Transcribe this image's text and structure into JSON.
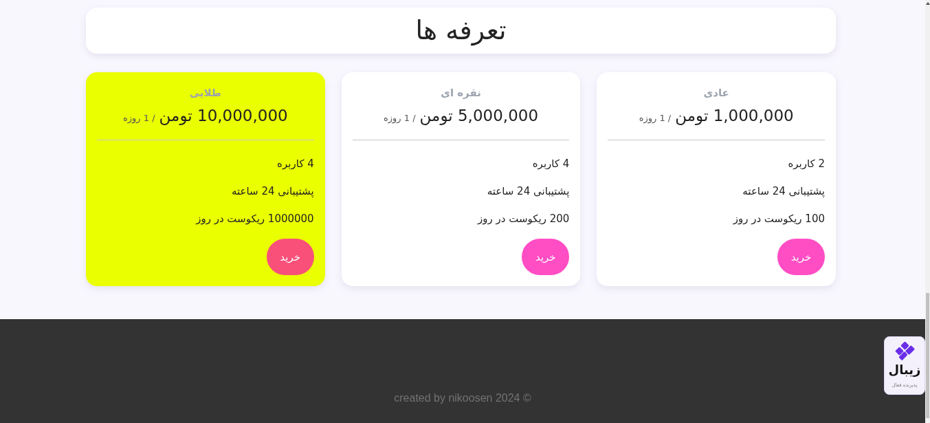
{
  "page": {
    "title": "تعرفه ها"
  },
  "plans": [
    {
      "name": "عادی",
      "price": "1,000,000 تومن",
      "period": "/ 1 روزه",
      "features": [
        "2 کاربره",
        "پشتیبانی 24 ساعته",
        "100 ریکوست در روز"
      ],
      "button": "خرید",
      "highlighted": false
    },
    {
      "name": "نقره ای",
      "price": "5,000,000 تومن",
      "period": "/ 1 روزه",
      "features": [
        "4 کاربره",
        "پشتیبانی 24 ساعته",
        "200 ریکوست در روز"
      ],
      "button": "خرید",
      "highlighted": false
    },
    {
      "name": "طلایی",
      "price": "10,000,000 تومن",
      "period": "/ 1 روزه",
      "features": [
        "4 کاربره",
        "پشتیبانی 24 ساعته",
        "1000000 ریکوست در روز"
      ],
      "button": "خرید",
      "highlighted": true
    }
  ],
  "footer": {
    "text": "created by nikoosen 2024 ©"
  },
  "badge": {
    "logo_text": "زیبال",
    "caption": "پذیرنده فعال"
  }
}
